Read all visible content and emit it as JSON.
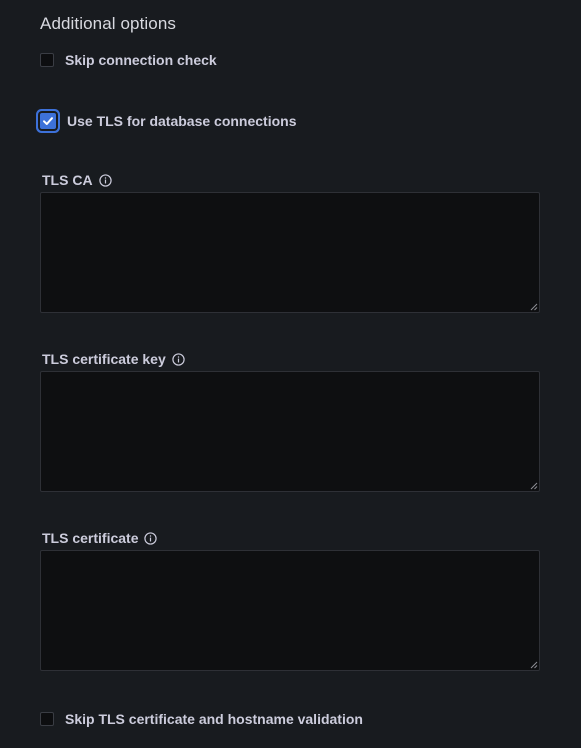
{
  "section": {
    "title": "Additional options"
  },
  "options": {
    "skip_connection_check": {
      "label": "Skip connection check",
      "checked": false
    },
    "use_tls": {
      "label": "Use TLS for database connections",
      "checked": true
    },
    "skip_tls_validation": {
      "label": "Skip TLS certificate and hostname validation",
      "checked": false
    }
  },
  "fields": {
    "tls_ca": {
      "label": "TLS CA",
      "value": "",
      "icon": "info-icon"
    },
    "tls_certificate_key": {
      "label": "TLS certificate key",
      "value": "",
      "icon": "info-icon"
    },
    "tls_certificate": {
      "label": "TLS certificate",
      "value": "",
      "icon": "info-icon"
    }
  },
  "colors": {
    "background": "#181b1f",
    "accent": "#3d71d9",
    "input_background": "#0e0f11"
  }
}
